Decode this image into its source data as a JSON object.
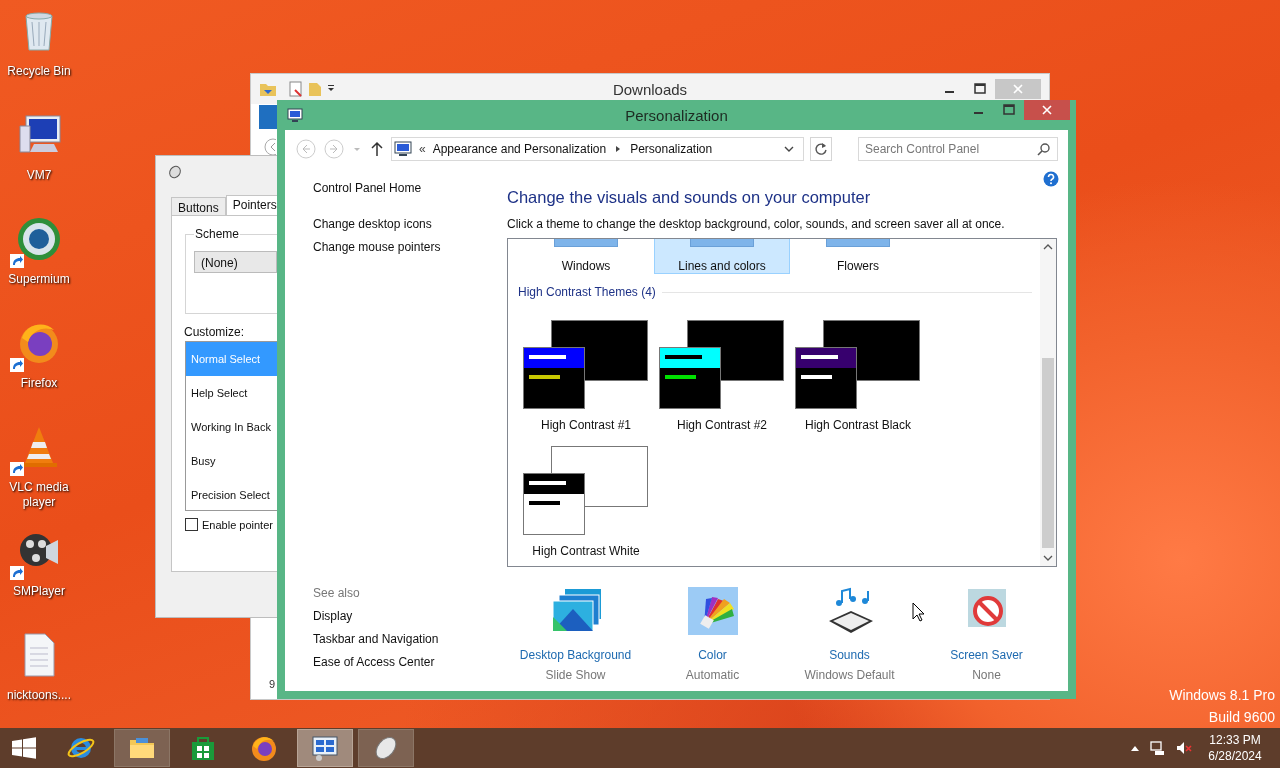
{
  "desktop": {
    "icons": [
      {
        "kind": "recycle",
        "label": "Recycle Bin",
        "shortcut": false
      },
      {
        "kind": "computer",
        "label": "VM7",
        "shortcut": false
      },
      {
        "kind": "globe",
        "label": "Supermium",
        "shortcut": true
      },
      {
        "kind": "fox",
        "label": "Firefox",
        "shortcut": true
      },
      {
        "kind": "cone",
        "label": "VLC media player",
        "shortcut": true
      },
      {
        "kind": "film",
        "label": "SMPlayer",
        "shortcut": true
      },
      {
        "kind": "document",
        "label": "nicktoons....",
        "shortcut": false
      }
    ],
    "edition": "Windows 8.1 Pro",
    "build": "Build 9600"
  },
  "downloads_window": {
    "title": "Downloads",
    "status_fragment": "9"
  },
  "mouse_dialog": {
    "tabs": [
      {
        "label": "Buttons",
        "selected": false
      },
      {
        "label": "Pointers",
        "selected": true
      }
    ],
    "scheme_label": "Scheme",
    "scheme_value": "(None)",
    "customize_label": "Customize:",
    "pointers": [
      {
        "label": "Normal Select",
        "selected": true
      },
      {
        "label": "Help Select",
        "selected": false
      },
      {
        "label": "Working In Back",
        "selected": false
      },
      {
        "label": "Busy",
        "selected": false
      },
      {
        "label": "Precision Select",
        "selected": false
      }
    ],
    "checkbox": {
      "label": "Enable pointer",
      "checked": false
    }
  },
  "personalization": {
    "title": "Personalization",
    "breadcrumb_overflow": "«",
    "breadcrumb": [
      "Appearance and Personalization",
      "Personalization"
    ],
    "search": {
      "placeholder": "Search Control Panel"
    },
    "sidebar": {
      "items": [
        "Control Panel Home",
        "Change desktop icons",
        "Change mouse pointers"
      ]
    },
    "heading": "Change the visuals and sounds on your computer",
    "intro": "Click a theme to change the desktop background, color, sounds, and screen saver all at once.",
    "themes": [
      {
        "name": "Windows",
        "selected": false
      },
      {
        "name": "Lines and colors",
        "selected": true
      },
      {
        "name": "Flowers",
        "selected": false
      }
    ],
    "group": {
      "title": "High Contrast Themes (4)",
      "themes": [
        {
          "name": "High Contrast #1",
          "kind": "first"
        },
        {
          "name": "High Contrast #2",
          "kind": "second"
        },
        {
          "name": "High Contrast Black",
          "kind": "black"
        },
        {
          "name": "High Contrast White",
          "kind": "white"
        }
      ]
    },
    "see_also": {
      "label": "See also",
      "links": [
        "Display",
        "Taskbar and Navigation",
        "Ease of Access Center"
      ]
    },
    "settings": [
      {
        "kind": "background",
        "label": "Desktop Background",
        "value": "Slide Show",
        "selected": false
      },
      {
        "kind": "color",
        "label": "Color",
        "value": "Automatic",
        "selected": true
      },
      {
        "kind": "sounds",
        "label": "Sounds",
        "value": "Windows Default",
        "selected": false
      },
      {
        "kind": "saver",
        "label": "Screen Saver",
        "value": "None",
        "selected": false
      }
    ]
  },
  "taskbar": {
    "apps": [
      {
        "kind": "ie",
        "open": false,
        "selected": false
      },
      {
        "kind": "explorer",
        "open": true,
        "selected": false
      },
      {
        "kind": "store",
        "open": false,
        "selected": false
      },
      {
        "kind": "fox",
        "open": false,
        "selected": false
      },
      {
        "kind": "panel",
        "open": true,
        "selected": true
      },
      {
        "kind": "mouse",
        "open": true,
        "selected": false
      }
    ],
    "tray": {
      "time": "12:33 PM",
      "date": "6/28/2024"
    }
  }
}
